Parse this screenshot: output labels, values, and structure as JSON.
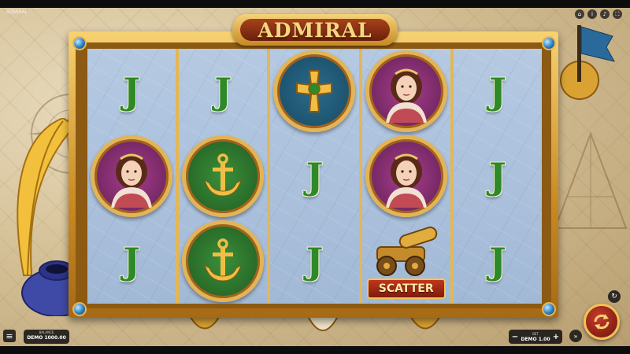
{
  "app": {
    "top_left_id": "ADMIRAL"
  },
  "game": {
    "title": "ADMIRAL",
    "reels": [
      [
        "J",
        "lady",
        "J"
      ],
      [
        "J",
        "anchor",
        "anchor"
      ],
      [
        "cross",
        "J",
        "J"
      ],
      [
        "lady",
        "lady",
        "scatter"
      ],
      [
        "J",
        "J",
        "J"
      ]
    ],
    "symbol_letter": "J",
    "scatter_label": "SCATTER"
  },
  "hud": {
    "balance_label": "BALANCE",
    "balance_value": "DEMO 1000.00",
    "bet_label": "BET",
    "bet_value": "DEMO 1.00",
    "minus": "−",
    "plus": "+"
  },
  "icons": {
    "menu": "≡",
    "autoplay": "↻",
    "turbo": "»",
    "top_controls": [
      "home-icon",
      "info-icon",
      "sound-icon",
      "fullscreen-icon"
    ]
  },
  "colors": {
    "gold": "#e3b456",
    "j_green": "#2e8a28",
    "reel_bg": "#aec3de",
    "spin_red": "#c63b2a"
  }
}
